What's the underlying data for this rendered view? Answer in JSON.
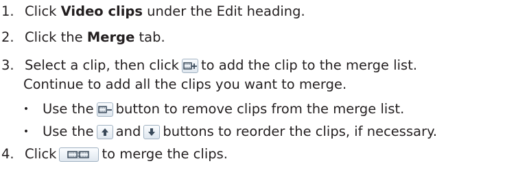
{
  "steps": {
    "s1": {
      "num": "1.",
      "pre": "Click ",
      "bold": "Video clips",
      "post": " under the Edit heading."
    },
    "s2": {
      "num": "2.",
      "pre": "Click the ",
      "bold": "Merge",
      "post": " tab."
    },
    "s3": {
      "num": "3.",
      "pre": "Select a clip, then click",
      "post": "to add the clip to the merge list.",
      "cont": "Continue to add all the clips you want to merge."
    },
    "b1": {
      "bullet": "•",
      "pre": "Use the",
      "post": "button to remove clips from the merge list."
    },
    "b2": {
      "bullet": "•",
      "pre": "Use the",
      "mid": "and",
      "post": "buttons to reorder the clips, if necessary."
    },
    "s4": {
      "num": "4.",
      "pre": "Click",
      "post": "to merge the clips."
    }
  },
  "icons": {
    "add": "add-clip-icon",
    "remove": "remove-clip-icon",
    "up": "arrow-up-icon",
    "down": "arrow-down-icon",
    "merge": "merge-clips-icon"
  },
  "colors": {
    "text": "#231f20",
    "icon_border": "#9fb0c0",
    "icon_ink": "#3a4a5a"
  }
}
